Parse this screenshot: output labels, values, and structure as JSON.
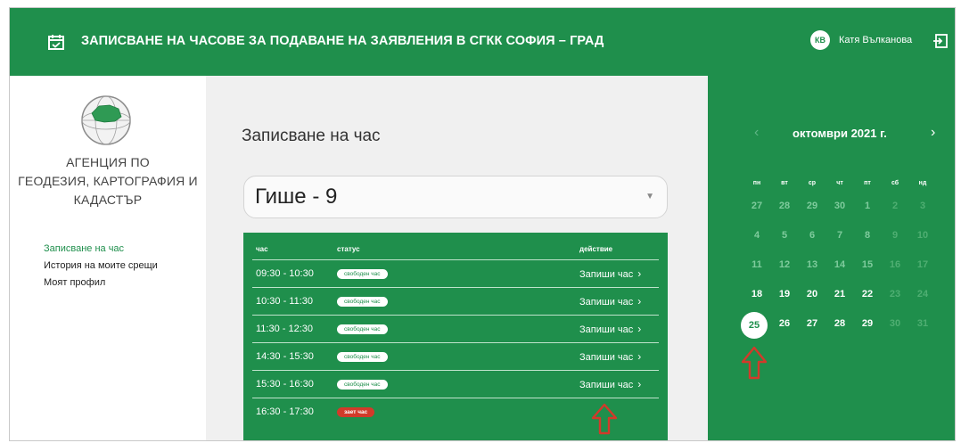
{
  "header": {
    "title": "ЗАПИСВАНЕ НА ЧАСОВЕ ЗА ПОДАВАНЕ НА ЗАЯВЛЕНИЯ В СГКК СОФИЯ – ГРАД",
    "user_initials": "КВ",
    "user_name": "Катя Вълканова",
    "icons": [
      "calendar-check-icon",
      "logout-icon"
    ],
    "color": "#1f8f4c"
  },
  "sidebar": {
    "agency_lines": [
      "АГЕНЦИЯ ПО",
      "ГЕОДЕЗИЯ, КАРТОГРАФИЯ И",
      "КАДАСТЪР"
    ],
    "nav": [
      {
        "label": "Записване на час",
        "active": true
      },
      {
        "label": "История на моите срещи",
        "active": false
      },
      {
        "label": "Моят профил",
        "active": false
      }
    ]
  },
  "main": {
    "title": "Записване на час",
    "select_value": "Гише - 9",
    "table": {
      "headers": {
        "time": "час",
        "status": "статус",
        "action": "действие"
      },
      "rows": [
        {
          "time": "09:30 - 10:30",
          "status": "свободен час",
          "action": "Запиши час"
        },
        {
          "time": "10:30 - 11:30",
          "status": "свободен час",
          "action": "Запиши час"
        },
        {
          "time": "11:30 - 12:30",
          "status": "свободен час",
          "action": "Запиши час"
        },
        {
          "time": "14:30 - 15:30",
          "status": "свободен час",
          "action": "Запиши час"
        },
        {
          "time": "15:30 - 16:30",
          "status": "свободен час",
          "action": "Запиши час"
        },
        {
          "time": "16:30 - 17:30",
          "status": "зает час",
          "action": ""
        }
      ]
    }
  },
  "calendar": {
    "prev": "‹",
    "next": "›",
    "month": "октомври 2021 г.",
    "weekdays": [
      "пн",
      "вт",
      "ср",
      "чт",
      "пт",
      "сб",
      "нд"
    ],
    "weeks": [
      [
        "27",
        "28",
        "29",
        "30",
        "1",
        "2",
        "3"
      ],
      [
        "4",
        "5",
        "6",
        "7",
        "8",
        "9",
        "10"
      ],
      [
        "11",
        "12",
        "13",
        "14",
        "15",
        "16",
        "17"
      ],
      [
        "18",
        "19",
        "20",
        "21",
        "22",
        "23",
        "24"
      ],
      [
        "25",
        "26",
        "27",
        "28",
        "29",
        "30",
        "31"
      ]
    ],
    "selected_day": "25",
    "annotation_color": "#d23a2a"
  }
}
